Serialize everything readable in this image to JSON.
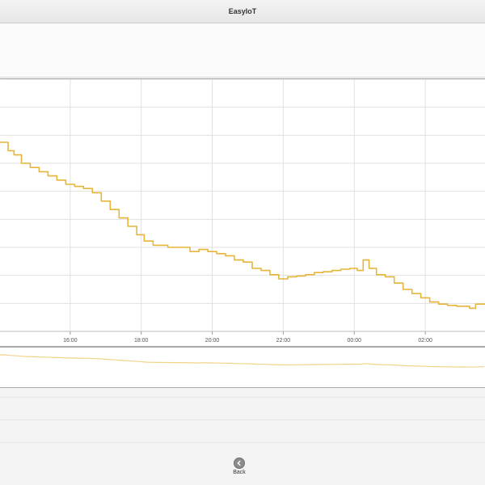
{
  "app": {
    "title": "EasyIoT"
  },
  "footer": {
    "back_label": "Back",
    "back_icon": "back-arrow-icon"
  },
  "colors": {
    "series": "#e6b53a",
    "navigator_series": "#f1d48a",
    "grid": "#e1e1e1"
  },
  "chart_data": {
    "type": "line",
    "title": "",
    "xlabel": "",
    "ylabel": "",
    "x_ticks": [
      "16:00",
      "18:00",
      "20:00",
      "22:00",
      "00:00",
      "02:00"
    ],
    "grid": true,
    "series": [
      {
        "values": [
          [
            "14:00",
            67.9
          ],
          [
            "14:10",
            67.9
          ],
          [
            "14:20",
            67.7
          ],
          [
            "14:30",
            67.6
          ],
          [
            "14:45",
            67.4
          ],
          [
            "15:00",
            67.3
          ],
          [
            "15:15",
            67.2
          ],
          [
            "15:30",
            67.1
          ],
          [
            "15:45",
            67.0
          ],
          [
            "16:00",
            66.9
          ],
          [
            "16:15",
            66.85
          ],
          [
            "16:30",
            66.8
          ],
          [
            "16:45",
            66.7
          ],
          [
            "17:00",
            66.5
          ],
          [
            "17:15",
            66.3
          ],
          [
            "17:30",
            66.1
          ],
          [
            "17:45",
            65.9
          ],
          [
            "18:00",
            65.7
          ],
          [
            "18:10",
            65.55
          ],
          [
            "18:30",
            65.45
          ],
          [
            "19:00",
            65.4
          ],
          [
            "19:15",
            65.4
          ],
          [
            "19:30",
            65.3
          ],
          [
            "19:45",
            65.35
          ],
          [
            "20:00",
            65.3
          ],
          [
            "20:15",
            65.25
          ],
          [
            "20:30",
            65.2
          ],
          [
            "20:45",
            65.1
          ],
          [
            "21:00",
            65.05
          ],
          [
            "21:15",
            64.9
          ],
          [
            "21:30",
            64.85
          ],
          [
            "21:45",
            64.75
          ],
          [
            "22:00",
            64.65
          ],
          [
            "22:15",
            64.7
          ],
          [
            "22:30",
            64.72
          ],
          [
            "22:45",
            64.75
          ],
          [
            "23:00",
            64.8
          ],
          [
            "23:15",
            64.82
          ],
          [
            "23:30",
            64.85
          ],
          [
            "23:45",
            64.88
          ],
          [
            "00:00",
            64.9
          ],
          [
            "00:10",
            64.85
          ],
          [
            "00:20",
            65.1
          ],
          [
            "00:30",
            64.9
          ],
          [
            "00:45",
            64.75
          ],
          [
            "01:00",
            64.7
          ],
          [
            "01:15",
            64.55
          ],
          [
            "01:30",
            64.4
          ],
          [
            "01:45",
            64.3
          ],
          [
            "02:00",
            64.2
          ],
          [
            "02:15",
            64.1
          ],
          [
            "02:30",
            64.05
          ],
          [
            "02:45",
            64.02
          ],
          [
            "03:00",
            64.0
          ],
          [
            "03:10",
            64.0
          ],
          [
            "03:20",
            63.95
          ],
          [
            "03:30",
            64.05
          ],
          [
            "03:40",
            64.05
          ]
        ]
      }
    ],
    "ylim": [
      63.4,
      69.4
    ],
    "navigator": {
      "ylim": [
        58,
        70
      ]
    }
  }
}
